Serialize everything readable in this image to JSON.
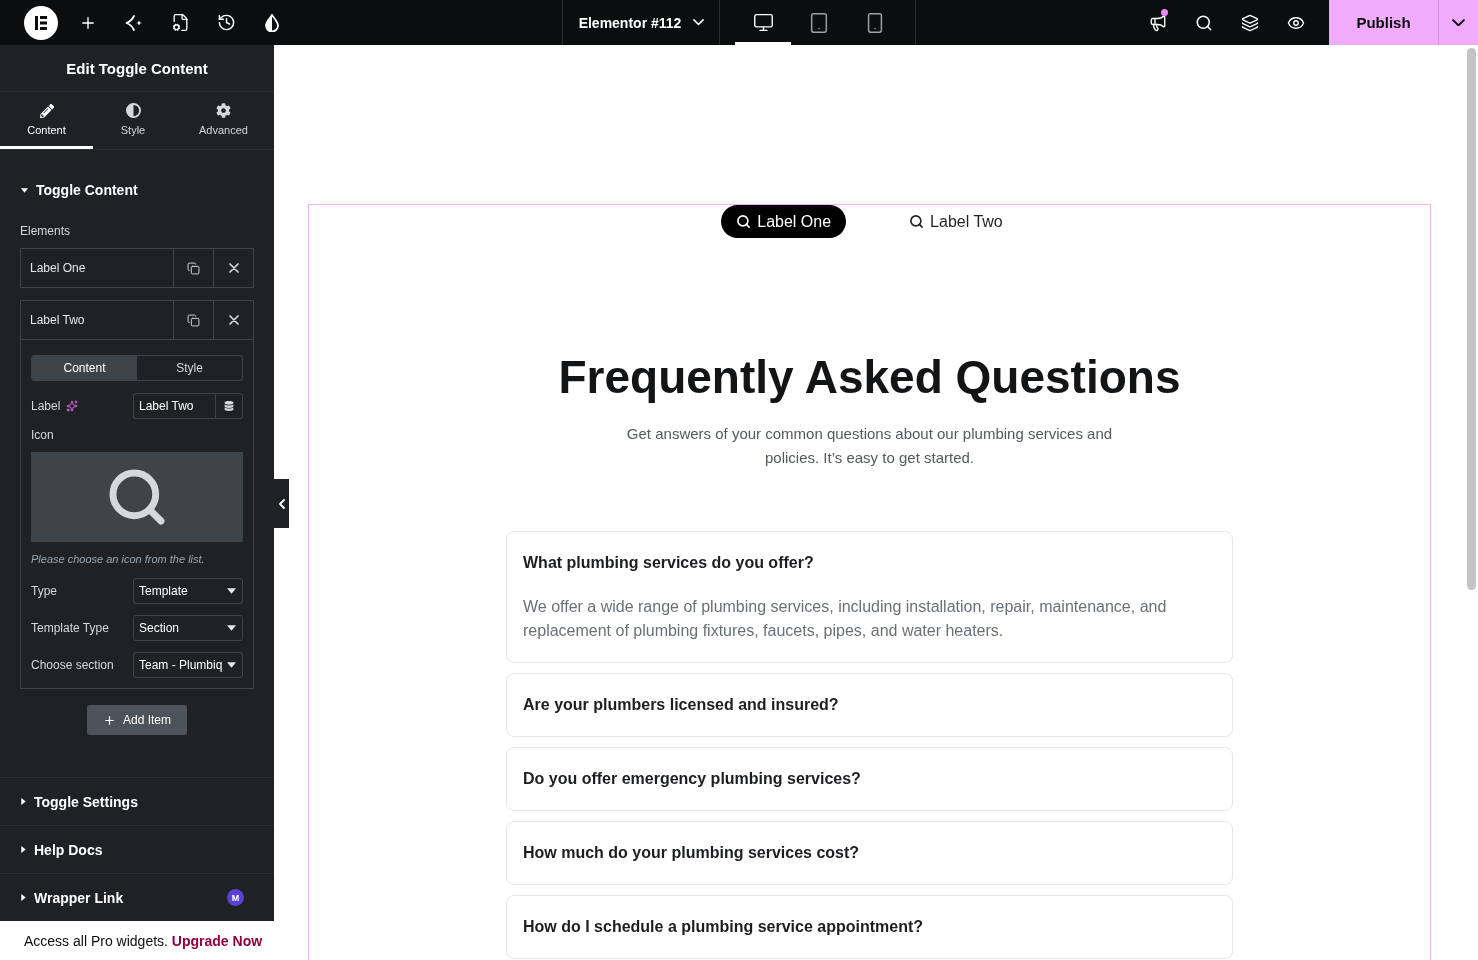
{
  "top_bar": {
    "document_title": "Elementor #112",
    "devices": [
      {
        "selected": true
      },
      {
        "selected": false
      },
      {
        "selected": false
      }
    ],
    "has_notification": true,
    "publish_button": "Publish"
  },
  "panel": {
    "title": "Edit Toggle Content",
    "tabs": [
      {
        "label": "Content",
        "selected": true
      },
      {
        "label": "Style",
        "selected": false
      },
      {
        "label": "Advanced",
        "selected": false
      }
    ],
    "sections": [
      {
        "title": "Toggle Content",
        "expanded": true,
        "elements_label": "Elements",
        "items": [
          {
            "title": "Label One",
            "expanded": false
          },
          {
            "title": "Label Two",
            "expanded": true,
            "tabs": [
              {
                "label": "Content",
                "selected": true
              },
              {
                "label": "Style",
                "selected": false
              }
            ],
            "label_field": {
              "label": "Label",
              "value": "Label Two"
            },
            "icon_field": {
              "label": "Icon",
              "hint": "Please choose an icon from the list."
            },
            "selects": [
              {
                "label": "Type",
                "value": "Template"
              },
              {
                "label": "Template Type",
                "value": "Section"
              },
              {
                "label": "Choose section",
                "value": "Team - Plumbiq"
              }
            ]
          }
        ],
        "add_button": "Add Item"
      },
      {
        "title": "Toggle Settings",
        "expanded": false
      },
      {
        "title": "Help Docs",
        "expanded": false
      },
      {
        "title": "Wrapper Link",
        "expanded": false,
        "badge": "M"
      }
    ],
    "promo": {
      "text": "Access all Pro widgets.",
      "link": "Upgrade Now"
    }
  },
  "canvas": {
    "toggle_tabs": [
      {
        "label": "Label One",
        "selected": true
      },
      {
        "label": "Label Two",
        "selected": false
      }
    ],
    "heading": "Frequently Asked Questions",
    "subheading": "Get answers of your common questions about our plumbing services and policies. It’s easy to get started.",
    "faq": [
      {
        "question": "What plumbing services do you offer?",
        "expanded": true,
        "answer": "We offer a wide range of plumbing services, including installation, repair, maintenance, and replacement of plumbing fixtures, faucets, pipes, and water heaters."
      },
      {
        "question": "Are your plumbers licensed and insured?",
        "expanded": false
      },
      {
        "question": "Do you offer emergency plumbing services?",
        "expanded": false
      },
      {
        "question": "How much do your plumbing services cost?",
        "expanded": false
      },
      {
        "question": "How do I schedule a plumbing service appointment?",
        "expanded": false
      }
    ]
  }
}
